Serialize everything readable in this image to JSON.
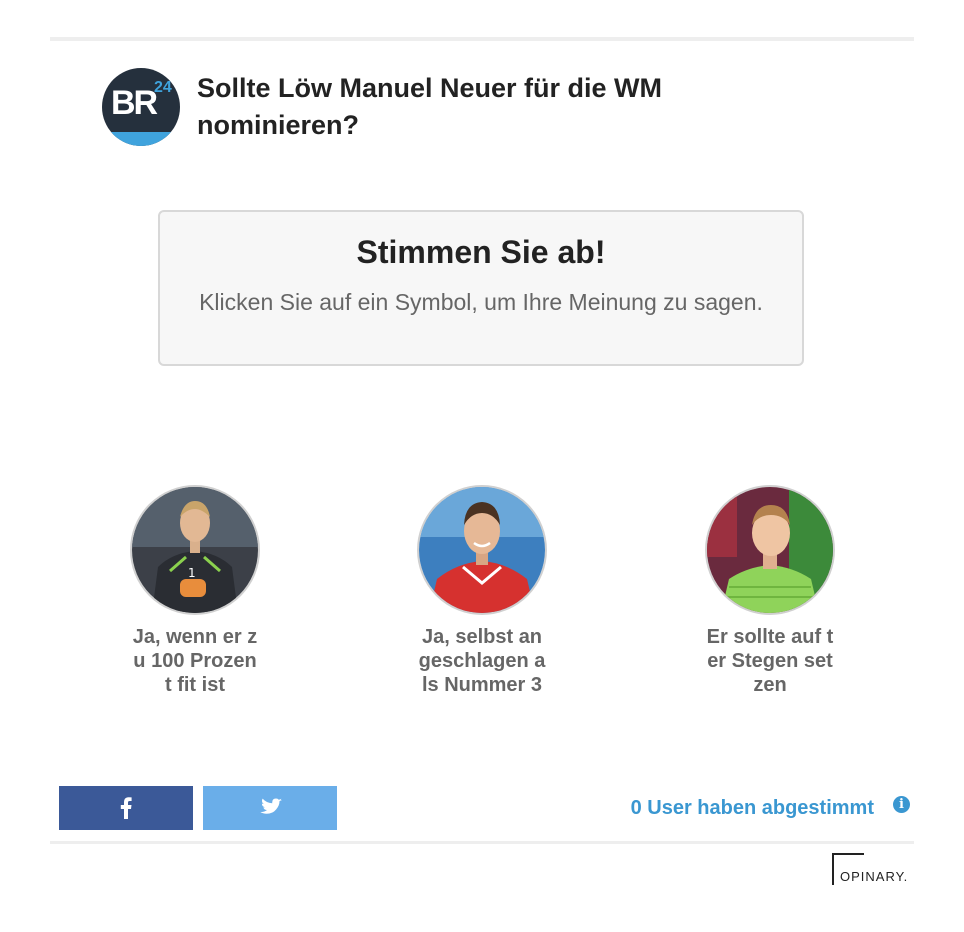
{
  "header": {
    "logo_text": "BR",
    "logo_number": "24",
    "question": "Sollte Löw Manuel Neuer für die WM nominieren?"
  },
  "prompt": {
    "title": "Stimmen Sie ab!",
    "subtitle": "Klicken Sie auf ein Symbol, um Ihre Meinung zu sagen."
  },
  "options": [
    {
      "label": "Ja, wenn er zu 100 Prozent fit ist",
      "image": "goalkeeper-in-dark-kit"
    },
    {
      "label": "Ja, selbst angeschlagen als Nummer 3",
      "image": "goalkeeper-in-red-kit"
    },
    {
      "label": "Er sollte auf ter Stegen setzen",
      "image": "goalkeeper-in-green-kit"
    }
  ],
  "share": {
    "facebook_icon": "facebook-icon",
    "twitter_icon": "twitter-icon"
  },
  "footer": {
    "vote_count": "0 User haben abgestimmt",
    "info_icon": "info-icon",
    "brand": "OPINARY."
  },
  "colors": {
    "facebook": "#3b5998",
    "twitter": "#6aaee9",
    "accent": "#3a97d1",
    "br_navy": "#25303d",
    "br_blue": "#3fa3dd"
  }
}
